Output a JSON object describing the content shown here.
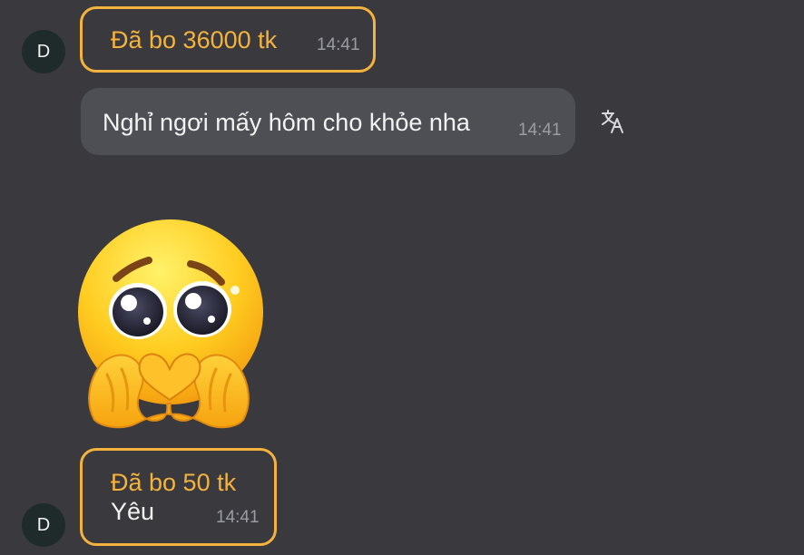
{
  "messages": {
    "avatar_initial": "D",
    "tip_1": {
      "label": "Đã bo 36000 tk",
      "time": "14:41"
    },
    "text_1": {
      "text": "Nghỉ ngơi mấy hôm cho khỏe nha",
      "time": "14:41"
    },
    "tip_2": {
      "label": "Đã bo 50 tk",
      "message": "Yêu",
      "time": "14:41"
    }
  },
  "icons": {
    "translate": "translate-icon",
    "sticker": "pleading-face-heart-hands-sticker"
  },
  "colors": {
    "background": "#3a3a3e",
    "tip_accent": "#f3b33d",
    "bubble": "#4e4f54",
    "text": "#f2f2f2",
    "timestamp": "#9b9ca2"
  }
}
